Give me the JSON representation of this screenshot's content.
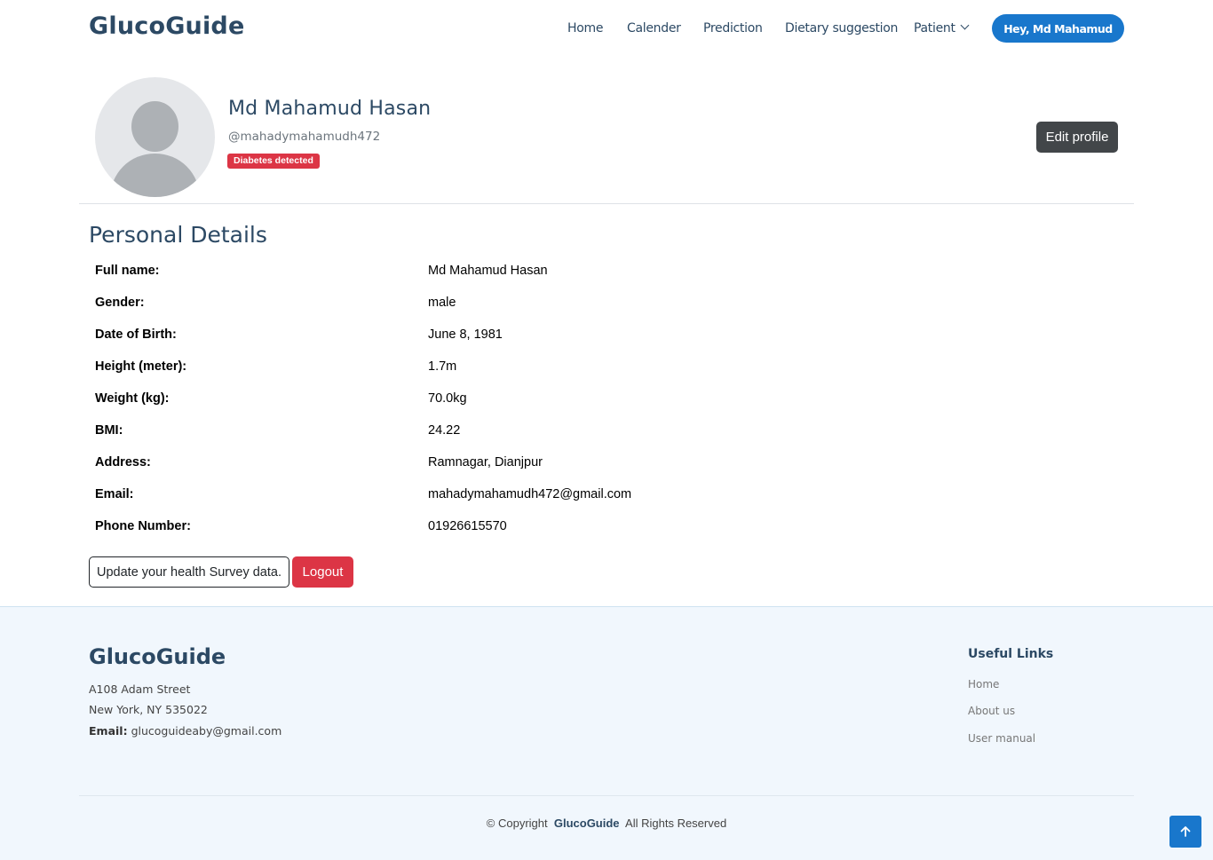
{
  "header": {
    "logo": "GlucoGuide",
    "nav": [
      "Home",
      "Calender",
      "Prediction",
      "Dietary suggestion",
      "Patient"
    ],
    "user_button": "Hey, Md Mahamud"
  },
  "profile": {
    "name": "Md Mahamud Hasan",
    "username": "@mahadymahamudh472",
    "badge": "Diabetes detected",
    "edit_label": "Edit profile"
  },
  "details": {
    "title": "Personal Details",
    "rows": [
      {
        "label": "Full name:",
        "value": "Md Mahamud Hasan"
      },
      {
        "label": "Gender:",
        "value": "male"
      },
      {
        "label": "Date of Birth:",
        "value": "June 8, 1981"
      },
      {
        "label": "Height (meter):",
        "value": "1.7m"
      },
      {
        "label": "Weight (kg):",
        "value": "70.0kg"
      },
      {
        "label": "BMI:",
        "value": "24.22"
      },
      {
        "label": "Address:",
        "value": "Ramnagar, Dianjpur"
      },
      {
        "label": "Email:",
        "value": "mahadymahamudh472@gmail.com"
      },
      {
        "label": "Phone Number:",
        "value": "01926615570"
      }
    ],
    "survey_button": "Update your health Survey data.",
    "logout_button": "Logout"
  },
  "footer": {
    "logo": "GlucoGuide",
    "address_line1": "A108 Adam Street",
    "address_line2": "New York, NY 535022",
    "email_label": "Email:",
    "email": "glucoguideaby@gmail.com",
    "useful_title": "Useful Links",
    "links": [
      "Home",
      "About us",
      "User manual"
    ],
    "copyright_prefix": "© Copyright",
    "copyright_brand": "GlucoGuide",
    "copyright_suffix": "All Rights Reserved"
  },
  "colors": {
    "primary": "#1977cc",
    "heading": "#2c4964",
    "danger": "#dc3545",
    "dark_button": "#424649",
    "footer_bg": "#f1f7fd"
  },
  "icons": {
    "dropdown": "chevron-down-icon",
    "back_to_top": "arrow-up-icon",
    "avatar": "user-avatar-icon"
  }
}
